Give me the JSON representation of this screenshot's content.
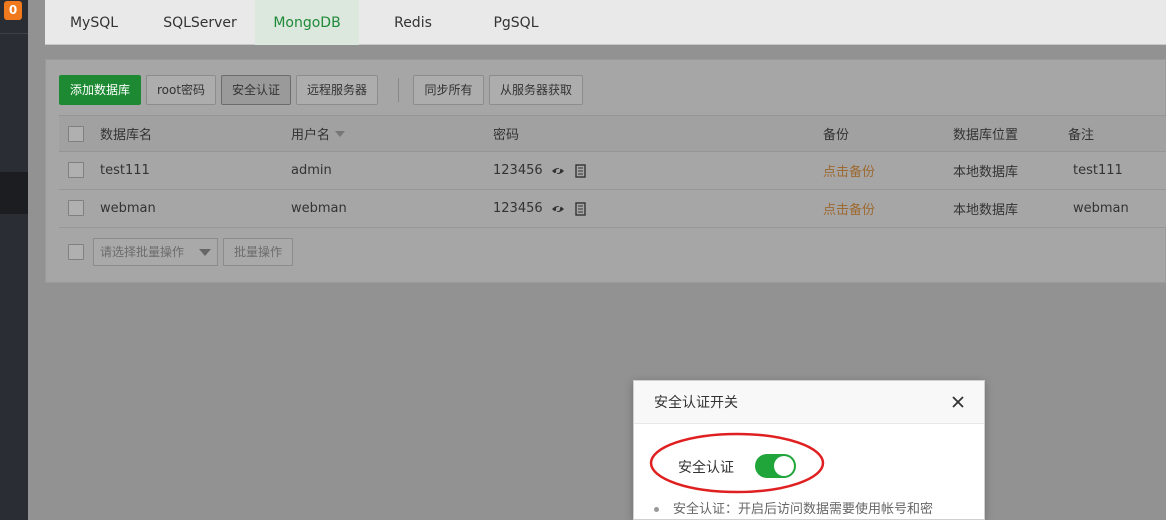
{
  "sidebar": {
    "badge": "0"
  },
  "tabs": [
    {
      "label": "MySQL",
      "active": false
    },
    {
      "label": "SQLServer",
      "active": false
    },
    {
      "label": "MongoDB",
      "active": true
    },
    {
      "label": "Redis",
      "active": false
    },
    {
      "label": "PgSQL",
      "active": false
    }
  ],
  "toolbar": {
    "add_db": "添加数据库",
    "root_password": "root密码",
    "security_auth": "安全认证",
    "remote_server": "远程服务器",
    "sync_all": "同步所有",
    "fetch_from_server": "从服务器获取"
  },
  "table": {
    "headers": {
      "db_name": "数据库名",
      "username": "用户名",
      "password": "密码",
      "backup": "备份",
      "location": "数据库位置",
      "remark": "备注"
    },
    "rows": [
      {
        "db_name": "test111",
        "username": "admin",
        "password": "123456",
        "backup": "点击备份",
        "location": "本地数据库",
        "remark": "test111"
      },
      {
        "db_name": "webman",
        "username": "webman",
        "password": "123456",
        "backup": "点击备份",
        "location": "本地数据库",
        "remark": "webman"
      }
    ]
  },
  "batch": {
    "select_placeholder": "请选择批量操作",
    "button": "批量操作"
  },
  "dialog": {
    "title": "安全认证开关",
    "toggle_label": "安全认证",
    "toggle_on": true,
    "note": "安全认证：开启后访问数据需要使用帐号和密"
  },
  "colors": {
    "accent_green": "#20a53a",
    "link_orange": "#9d6a31",
    "highlight_red": "#e02020"
  }
}
